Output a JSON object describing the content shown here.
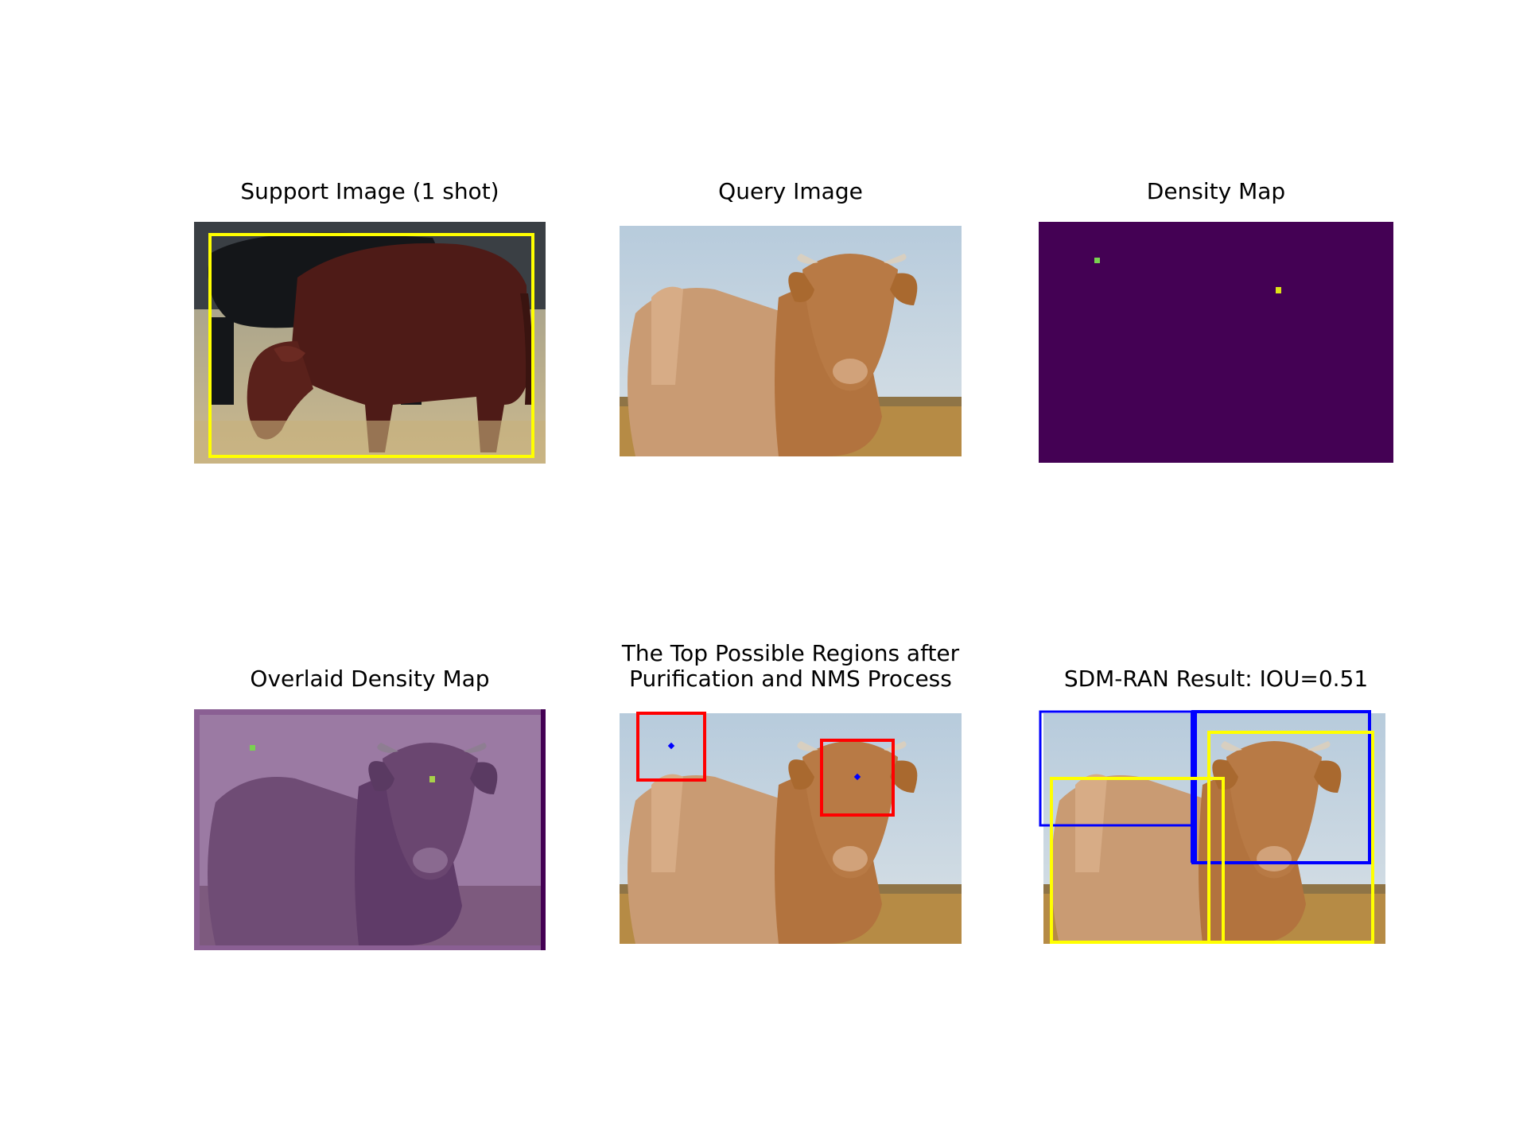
{
  "panels": {
    "support": {
      "title": "Support Image (1 shot)"
    },
    "query": {
      "title": "Query Image"
    },
    "density": {
      "title": "Density Map"
    },
    "overlaid": {
      "title": "Overlaid Density Map"
    },
    "regions": {
      "title": "The Top Possible Regions after\nPurification and NMS Process"
    },
    "result": {
      "title": "SDM-RAN Result: IOU=0.51"
    }
  },
  "colors": {
    "viridis_low": "#440154",
    "viridis_high": "#dde318",
    "viridis_mid": "#7ad151",
    "box_yellow": "#ffff00",
    "box_red": "#ff0000",
    "box_blue": "#0000ff"
  }
}
